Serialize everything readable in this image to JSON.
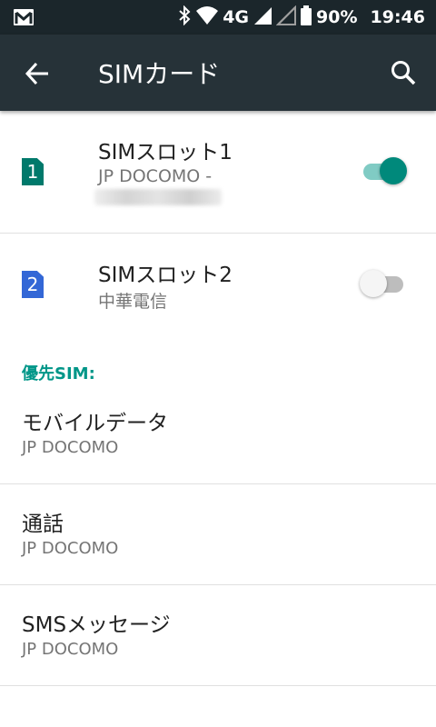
{
  "status_bar": {
    "network": "4G",
    "battery": "90%",
    "time": "19:46"
  },
  "toolbar": {
    "title": "SIMカード"
  },
  "sim_slots": [
    {
      "badge": "1",
      "title": "SIMスロット1",
      "subtitle": "JP DOCOMO -",
      "enabled": true,
      "badge_color": "#00796b"
    },
    {
      "badge": "2",
      "title": "SIMスロット2",
      "subtitle": "中華電信",
      "enabled": false,
      "badge_color": "#3367d6"
    }
  ],
  "preferred": {
    "header": "優先SIM:",
    "items": [
      {
        "title": "モバイルデータ",
        "value": "JP DOCOMO"
      },
      {
        "title": "通話",
        "value": "JP DOCOMO"
      },
      {
        "title": "SMSメッセージ",
        "value": "JP DOCOMO"
      }
    ]
  },
  "colors": {
    "accent": "#009688",
    "toolbar": "#263238",
    "statusbar": "#1b262b"
  }
}
